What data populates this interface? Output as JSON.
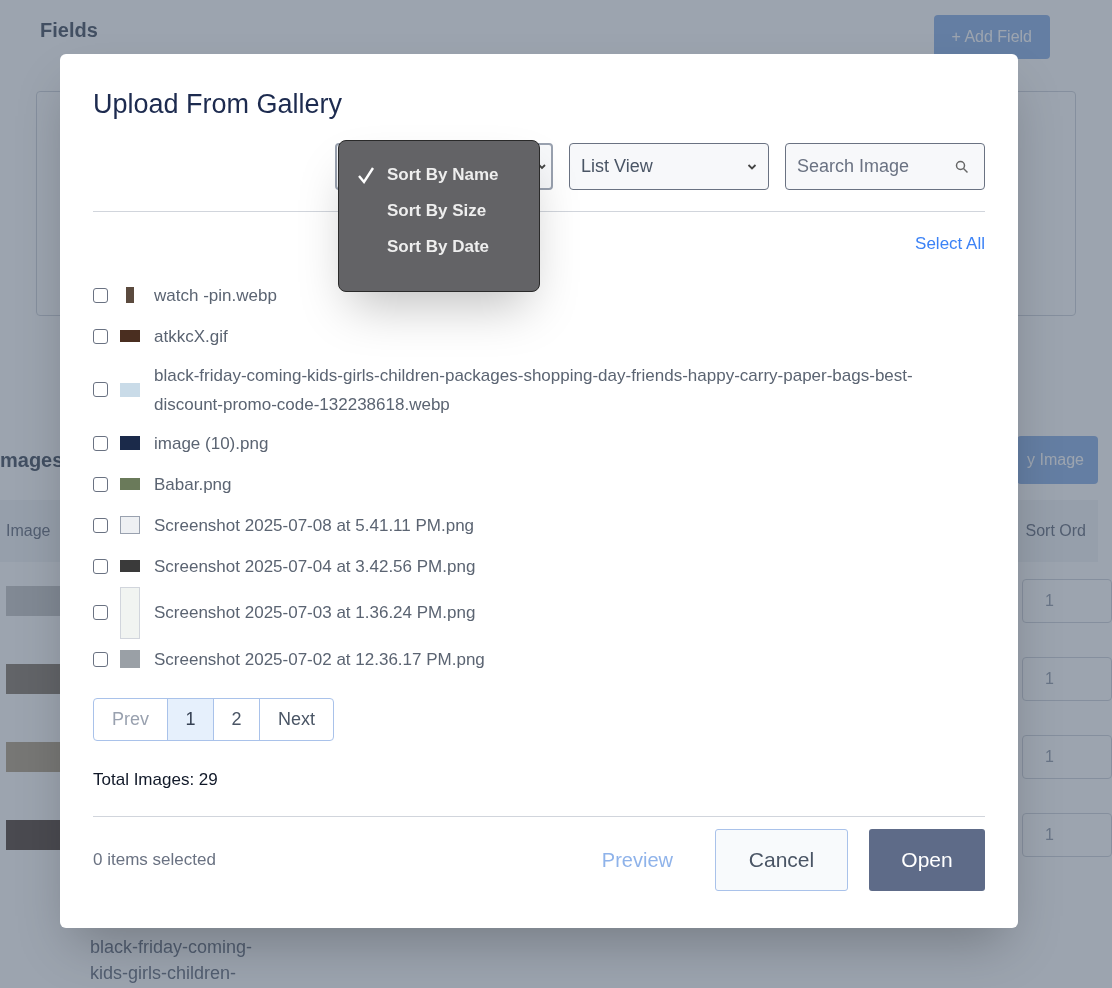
{
  "background": {
    "section_title": "Fields",
    "add_button": "+ Add Field",
    "images_title": "mages",
    "images_button": "y Image",
    "table_columns": [
      "Image",
      "Sort Ord"
    ],
    "rows": [
      {
        "sort_order": "1"
      },
      {
        "sort_order": "1"
      },
      {
        "sort_order": "1"
      },
      {
        "sort_order": "1"
      }
    ],
    "caption_lines": [
      "black-friday-coming-",
      "kids-girls-children-"
    ]
  },
  "dialog": {
    "title": "Upload From Gallery",
    "sort_menu": {
      "options": [
        {
          "label": "Sort By Name",
          "selected": true
        },
        {
          "label": "Sort By Size",
          "selected": false
        },
        {
          "label": "Sort By Date",
          "selected": false
        }
      ]
    },
    "view_select": {
      "value": "List View"
    },
    "search": {
      "placeholder": "Search Image"
    },
    "select_all": "Select All",
    "files": [
      {
        "name": "watch -pin.webp",
        "checked": false
      },
      {
        "name": "atkkcX.gif",
        "checked": false
      },
      {
        "name": "black-friday-coming-kids-girls-children-packages-shopping-day-friends-happy-carry-paper-bags-best-discount-promo-code-132238618.webp",
        "checked": false
      },
      {
        "name": "image (10).png",
        "checked": false
      },
      {
        "name": "Babar.png",
        "checked": false
      },
      {
        "name": "Screenshot 2025-07-08 at 5.41.11 PM.png",
        "checked": false
      },
      {
        "name": "Screenshot 2025-07-04 at 3.42.56 PM.png",
        "checked": false
      },
      {
        "name": "Screenshot 2025-07-03 at 1.36.24 PM.png",
        "checked": false
      },
      {
        "name": "Screenshot 2025-07-02 at 12.36.17 PM.png",
        "checked": false
      }
    ],
    "pagination": {
      "prev": {
        "label": "Prev",
        "disabled": true
      },
      "pages": [
        {
          "label": "1",
          "selected": true
        },
        {
          "label": "2",
          "selected": false
        }
      ],
      "next": {
        "label": "Next",
        "disabled": false
      }
    },
    "total": "Total Images: 29",
    "selected_count": "0 items selected",
    "buttons": {
      "preview": {
        "label": "Preview",
        "disabled": true
      },
      "cancel": "Cancel",
      "open": "Open"
    }
  }
}
